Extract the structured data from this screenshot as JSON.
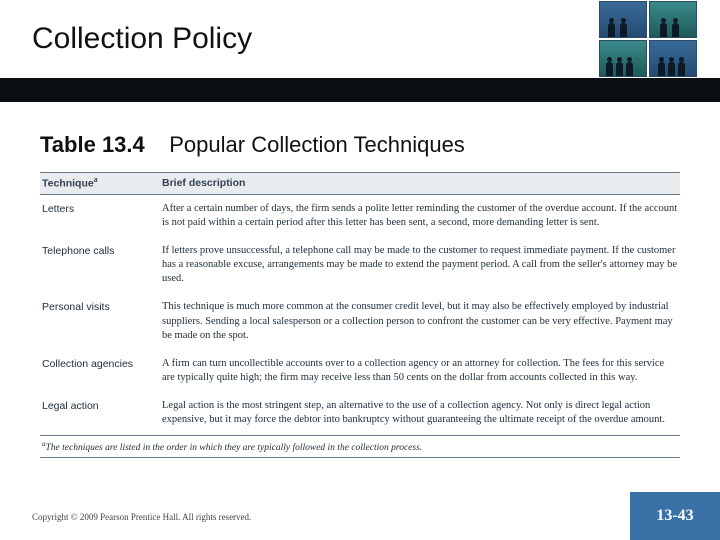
{
  "header": {
    "title": "Collection Policy"
  },
  "caption": {
    "number": "Table 13.4",
    "text": "Popular Collection Techniques"
  },
  "table": {
    "columns": {
      "technique": "Technique",
      "technique_sup": "a",
      "description": "Brief description"
    },
    "rows": [
      {
        "technique": "Letters",
        "description": "After a certain number of days, the firm sends a polite letter reminding the customer of the overdue account. If the account is not paid within a certain period after this letter has been sent, a second, more demanding letter is sent."
      },
      {
        "technique": "Telephone calls",
        "description": "If letters prove unsuccessful, a telephone call may be made to the customer to request immediate payment. If the customer has a reasonable excuse, arrangements may be made to extend the payment period. A call from the seller's attorney may be used."
      },
      {
        "technique": "Personal visits",
        "description": "This technique is much more common at the consumer credit level, but it may also be effectively employed by industrial suppliers. Sending a local salesperson or a collection person to confront the customer can be very effective. Payment may be made on the spot."
      },
      {
        "technique": "Collection agencies",
        "description": "A firm can turn uncollectible accounts over to a collection agency or an attorney for collection. The fees for this service are typically quite high; the firm may receive less than 50 cents on the dollar from accounts collected in this way."
      },
      {
        "technique": "Legal action",
        "description": "Legal action is the most stringent step, an alternative to the use of a collection agency. Not only is direct legal action expensive, but it may force the debtor into bankruptcy without guaranteeing the ultimate receipt of the overdue amount."
      }
    ],
    "footnote_sup": "a",
    "footnote": "The techniques are listed in the order in which they are typically followed in the collection process."
  },
  "footer": {
    "copyright": "Copyright © 2009 Pearson Prentice Hall. All rights reserved.",
    "page": "13-43"
  },
  "colors": {
    "bar": "#0a0f14",
    "pagetab": "#3a72a8",
    "rule": "#6a7a88",
    "headbg": "#e8ecef"
  }
}
